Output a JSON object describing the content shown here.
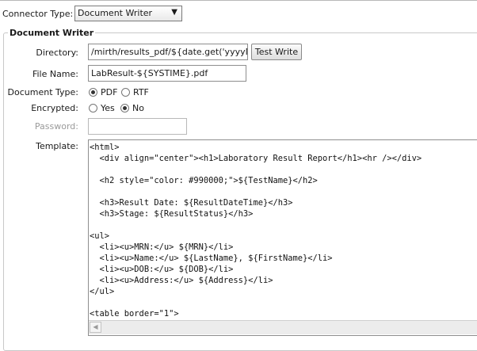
{
  "connector_type": {
    "label": "Connector Type:",
    "value": "Document Writer"
  },
  "section_title": "Document Writer",
  "directory": {
    "label": "Directory:",
    "value": "/mirth/results_pdf/${date.get('yyyyMMdd')}"
  },
  "test_write_label": "Test Write",
  "file_name": {
    "label": "File Name:",
    "value": "LabResult-${SYSTIME}.pdf"
  },
  "document_type": {
    "label": "Document Type:",
    "options": [
      "PDF",
      "RTF"
    ],
    "selected": "PDF"
  },
  "encrypted": {
    "label": "Encrypted:",
    "options": [
      "Yes",
      "No"
    ],
    "selected": "No"
  },
  "password": {
    "label": "Password:",
    "value": ""
  },
  "template": {
    "label": "Template:",
    "lines": [
      "<html>",
      "  <div align=\"center\"><h1>Laboratory Result Report</h1><hr /></div>",
      "",
      "  <h2 style=\"color: #990000;\">${TestName}</h2>",
      "",
      "  <h3>Result Date: ${ResultDateTime}</h3>",
      "  <h3>Stage: ${ResultStatus}</h3>",
      "",
      "<ul>",
      "  <li><u>MRN:</u> ${MRN}</li>",
      "  <li><u>Name:</u> ${LastName}, ${FirstName}</li>",
      "  <li><u>DOB:</u> ${DOB}</li>",
      "  <li><u>Address:</u> ${Address}</li>",
      "</ul>",
      "",
      "<table border=\"1\">"
    ]
  }
}
